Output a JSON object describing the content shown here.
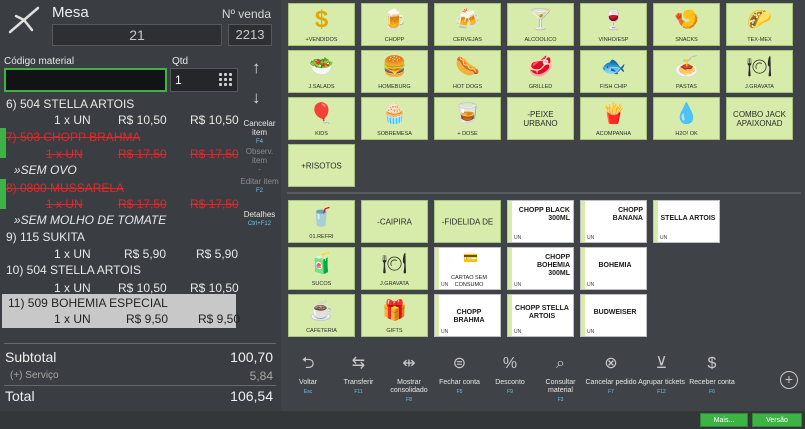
{
  "header": {
    "mesa_label": "Mesa",
    "venda_label": "Nº venda",
    "mesa_value": "21",
    "venda_value": "2213"
  },
  "inputs": {
    "codigo_label": "Código material",
    "qtd_label": "Qtd",
    "codigo_value": "",
    "qtd_value": "1"
  },
  "items": [
    {
      "title": "6) 504 STELLA ARTOIS",
      "qty": "1 x UN",
      "unit": "R$ 10,50",
      "total": "R$ 10,50",
      "cancelled": false
    },
    {
      "title": "7) 503 CHOPP BRAHMA",
      "qty": "1 x UN",
      "unit": "R$ 17,50",
      "total": "R$ 17,50",
      "cancelled": true,
      "sub": "»SEM OVO"
    },
    {
      "title": "8) 0800 MUSSARELA",
      "qty": "1 x UN",
      "unit": "R$ 17,50",
      "total": "R$ 17,50",
      "cancelled": true,
      "sub": "»SEM MOLHO DE TOMATE"
    },
    {
      "title": "9) 115 SUKITA",
      "qty": "1 x UN",
      "unit": "R$ 5,90",
      "total": "R$ 5,90",
      "cancelled": false
    },
    {
      "title": "10) 504 STELLA ARTOIS",
      "qty": "1 x UN",
      "unit": "R$ 10,50",
      "total": "R$ 10,50",
      "cancelled": false
    },
    {
      "title": "11) 509 BOHEMIA ESPECIAL",
      "qty": "1 x UN",
      "unit": "R$ 9,50",
      "total": "R$ 9,50",
      "cancelled": false,
      "selected": true
    }
  ],
  "side_actions": {
    "cancelar": "Cancelar item",
    "cancelar_key": "F4",
    "observ": "Observ. item",
    "observ_key": "-",
    "editar": "Editar item",
    "editar_key": "F2",
    "detalhes": "Detalhes",
    "detalhes_key": "Ctrl+F12"
  },
  "totals": {
    "subtotal_label": "Subtotal",
    "subtotal_value": "100,70",
    "servico_label": "(+) Serviço",
    "servico_value": "5,84",
    "total_label": "Total",
    "total_value": "106,54"
  },
  "groups": [
    {
      "label": "+VENDIDOS",
      "icon": "dollar-icon",
      "glyph": "$"
    },
    {
      "label": "CHOPP",
      "icon": "beer-mug-icon",
      "glyph": "🍺"
    },
    {
      "label": "CERVEJAS",
      "icon": "beer-icon",
      "glyph": "🍻"
    },
    {
      "label": "ALCOOLICO",
      "icon": "cocktail-icon",
      "glyph": "🍸"
    },
    {
      "label": "VINHO/ESP",
      "icon": "wine-icon",
      "glyph": "🍷"
    },
    {
      "label": "SNACKS",
      "icon": "snacks-icon",
      "glyph": "🍤"
    },
    {
      "label": "TEX-MEX",
      "icon": "taco-icon",
      "glyph": "🌮"
    },
    {
      "label": "J.SALADS",
      "icon": "salad-icon",
      "glyph": "🥗"
    },
    {
      "label": "HOMEBURG",
      "icon": "burger-icon",
      "glyph": "🍔"
    },
    {
      "label": "HOT DOGS",
      "icon": "hotdog-icon",
      "glyph": "🌭"
    },
    {
      "label": "GRILLED",
      "icon": "steak-icon",
      "glyph": "🥩"
    },
    {
      "label": "FISH CHIP",
      "icon": "fish-icon",
      "glyph": "🐟"
    },
    {
      "label": "PASTAS",
      "icon": "pasta-icon",
      "glyph": "🍝"
    },
    {
      "label": "J.GRAVATA",
      "icon": "menu-icon",
      "glyph": "🍽"
    },
    {
      "label": "KIDS",
      "icon": "balloon-icon",
      "glyph": "🎈"
    },
    {
      "label": "SOBREMESA",
      "icon": "dessert-icon",
      "glyph": "🧁"
    },
    {
      "label": "+ DOSE",
      "icon": "shot-icon",
      "glyph": "🥃"
    },
    {
      "label": "-PEIXE URBANO",
      "icon": "",
      "glyph": ""
    },
    {
      "label": "ACOMPANHA",
      "icon": "fries-icon",
      "glyph": "🍟"
    },
    {
      "label": "H2O! OK",
      "icon": "water-icon",
      "glyph": "💧"
    },
    {
      "label": "COMBO JACK APAIXONAD",
      "icon": "",
      "glyph": ""
    },
    {
      "label": "+RISOTOS",
      "icon": "",
      "glyph": ""
    }
  ],
  "products": {
    "refri": "01.REFRI",
    "caipira": "-CAIPIRA",
    "fidelidade": "-FIDELIDA DE",
    "chopp_black": "CHOPP BLACK 300ML",
    "chopp_banana": "CHOPP BANANA",
    "stella": "STELLA ARTOIS",
    "sucos": "SUCOS",
    "j_gravata": "J.GRAVATA",
    "cartao": "CARTAO SEM CONSUMO",
    "chopp_bohemia": "CHOPP BOHEMIA 300ML",
    "bohemia": "BOHEMIA",
    "cafeteria": "CAFETERIA",
    "gifts": "GIFTS",
    "chopp_brahma": "CHOPP BRAHMA",
    "chopp_stella": "CHOPP STELLA ARTOIS",
    "budweiser": "BUDWEISER",
    "unit": "UN"
  },
  "toolbar": [
    {
      "label": "Voltar",
      "key": "Esc",
      "icon": "undo-icon",
      "glyph": "⮌"
    },
    {
      "label": "Transferir",
      "key": "F11",
      "icon": "transfer-icon",
      "glyph": "⇆"
    },
    {
      "label": "Mostrar consolidado",
      "key": "F8",
      "icon": "consolidate-icon",
      "glyph": "⇹"
    },
    {
      "label": "Fechar conta",
      "key": "F5",
      "icon": "close-bill-icon",
      "glyph": "⊜"
    },
    {
      "label": "Desconto",
      "key": "F9",
      "icon": "discount-icon",
      "glyph": "%"
    },
    {
      "label": "Consultar material",
      "key": "F3",
      "icon": "consult-icon",
      "glyph": "⌕"
    },
    {
      "label": "Cancelar pedido",
      "key": "F7",
      "icon": "cancel-icon",
      "glyph": "⊗"
    },
    {
      "label": "Agrupar tickets",
      "key": "F12",
      "icon": "group-icon",
      "glyph": "⊻"
    },
    {
      "label": "Receber conta",
      "key": "F6",
      "icon": "dollar-icon",
      "glyph": "$"
    }
  ],
  "footer": {
    "mais": "Mais...",
    "versao": "Versão"
  }
}
